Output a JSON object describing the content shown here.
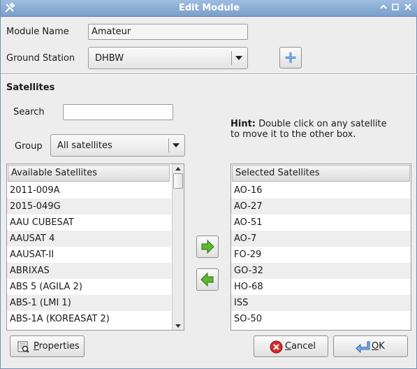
{
  "window": {
    "title": "Edit Module"
  },
  "form": {
    "module_name_label": "Module Name",
    "module_name_value": "Amateur",
    "ground_station_label": "Ground Station",
    "ground_station_value": "DHBW"
  },
  "satellites": {
    "section_title": "Satellites",
    "search_label": "Search",
    "search_value": "",
    "group_label": "Group",
    "group_value": "All satellites",
    "hint_bold": "Hint:",
    "hint_line1": " Double click on any satellite",
    "hint_line2": "to move it to the other box.",
    "available_header": "Available Satellites",
    "available": [
      "2011-009A",
      "2015-049G",
      "AAU CUBESAT",
      "AAUSAT 4",
      "AAUSAT-II",
      "ABRIXAS",
      "ABS 5 (AGILA 2)",
      "ABS-1 (LMI 1)",
      "ABS-1A (KOREASAT 2)"
    ],
    "selected_header": "Selected Satellites",
    "selected": [
      "AO-16",
      "AO-27",
      "AO-51",
      "AO-7",
      "FO-29",
      "GO-32",
      "HO-68",
      "ISS",
      "SO-50"
    ]
  },
  "buttons": {
    "properties_label_u": "P",
    "properties_label_rest": "roperties",
    "cancel_label_u": "C",
    "cancel_label_rest": "ancel",
    "ok_label_u": "O",
    "ok_label_rest": "K"
  },
  "colors": {
    "titlebar": "#8eb0da",
    "add_icon": "#3d7fd6",
    "arrow_green": "#5cb82e",
    "cancel_red": "#d62b2b",
    "ok_blue": "#3b78d0"
  }
}
